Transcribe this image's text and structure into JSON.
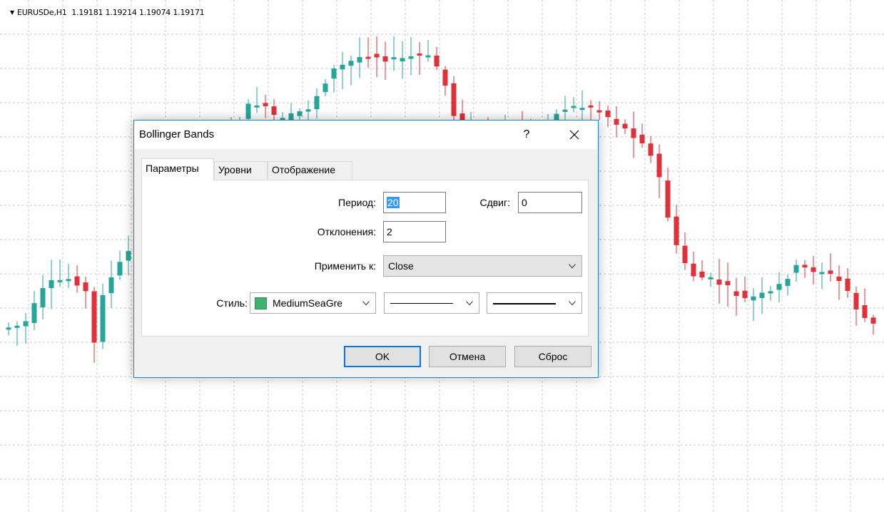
{
  "chart": {
    "symbol": "EURUSDe,H1",
    "ohlc": "1.19181 1.19214 1.19074 1.19171",
    "colors": {
      "bull": "#26a69a",
      "bear": "#e0303a",
      "grid": "#c8c8c8",
      "wick": "#e0303a"
    }
  },
  "dialog": {
    "title": "Bollinger Bands",
    "help": "?",
    "tabs": [
      "Параметры",
      "Уровни",
      "Отображение"
    ],
    "active_tab": "Параметры",
    "period_label": "Период:",
    "period_value": "20",
    "shift_label": "Сдвиг:",
    "shift_value": "0",
    "deviations_label": "Отклонения:",
    "deviations_value": "2",
    "apply_label": "Применить к:",
    "apply_value": "Close",
    "style_label": "Стиль:",
    "style_color_name": "MediumSeaGre",
    "style_color": "#3cb371",
    "buttons": {
      "ok": "OK",
      "cancel": "Отмена",
      "reset": "Сброс"
    }
  }
}
